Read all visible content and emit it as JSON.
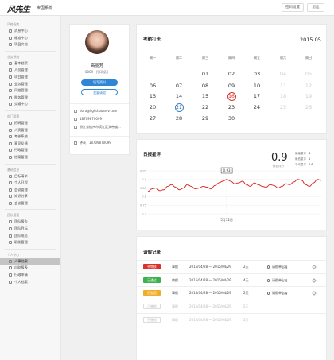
{
  "header": {
    "logo": "风先生",
    "subtitle": "帝国系统",
    "btn_password": "密码设置",
    "btn_exit": "退出"
  },
  "sidebar": {
    "sections": [
      {
        "title": "风格指南",
        "items": [
          "消息中心",
          "标准中心",
          "项目文档"
        ]
      },
      {
        "title": "业务系统",
        "items": [
          "基本档案",
          "人员管理",
          "项目管理",
          "业务管理",
          "风控管理",
          "税务管理",
          "交通中心"
        ]
      },
      {
        "title": "部门管理",
        "items": [
          "招聘管理",
          "人资管理",
          "考核系统",
          "意见反馈",
          "行政管理",
          "档案管理"
        ]
      },
      {
        "title": "基础信息",
        "items": [
          "目标清单",
          "个人日程",
          "会议管理",
          "知识分享",
          "会议管理"
        ]
      },
      {
        "title": "团队管理",
        "items": [
          "团队报告",
          "团队目标",
          "团队成员",
          "职能管理"
        ]
      },
      {
        "title": "个人中心",
        "items": [
          "人事档案",
          "自助报表",
          "行政申请",
          "个人档案"
        ]
      }
    ],
    "active": "人事档案"
  },
  "profile": {
    "name": "高丽芳",
    "employee_id": "0009",
    "position": "打印设计",
    "btn_primary": "填写资料",
    "btn_secondary": "我要请假",
    "email": "dora@lighthouse-v.com",
    "phone": "18709870099",
    "address": "浙江省杭州市滨江区关帝庙...",
    "landline_label": "钟表",
    "landline": "18709870099"
  },
  "calendar": {
    "title": "考勤打卡",
    "month": "2015.05",
    "weekdays": [
      "周一",
      "周二",
      "周三",
      "周四",
      "周五",
      "周六",
      "周日"
    ],
    "rows": [
      [
        {
          "d": ""
        },
        {
          "d": ""
        },
        {
          "d": "01"
        },
        {
          "d": "02"
        },
        {
          "d": "03"
        },
        {
          "d": "04",
          "dim": true
        },
        {
          "d": "05",
          "dim": true
        }
      ],
      [
        {
          "d": "06"
        },
        {
          "d": "07"
        },
        {
          "d": "08"
        },
        {
          "d": "09"
        },
        {
          "d": "10"
        },
        {
          "d": "11",
          "dim": true
        },
        {
          "d": "12",
          "dim": true
        }
      ],
      [
        {
          "d": "13"
        },
        {
          "d": "14"
        },
        {
          "d": "15"
        },
        {
          "d": "16",
          "ring": "red"
        },
        {
          "d": "17"
        },
        {
          "d": "18",
          "dim": true
        },
        {
          "d": "19",
          "dim": true
        }
      ],
      [
        {
          "d": "20"
        },
        {
          "d": "21",
          "ring": "blue"
        },
        {
          "d": "22"
        },
        {
          "d": "23"
        },
        {
          "d": "24"
        },
        {
          "d": "25",
          "dim": true
        },
        {
          "d": "26",
          "dim": true
        }
      ],
      [
        {
          "d": "27"
        },
        {
          "d": "28"
        },
        {
          "d": "29"
        },
        {
          "d": "30"
        },
        {
          "d": ""
        },
        {
          "d": ""
        },
        {
          "d": ""
        }
      ]
    ]
  },
  "rating": {
    "title": "日报星评",
    "score": "0.9",
    "score_sub": "综合评分",
    "legend": [
      {
        "label": "最高星评",
        "value": "4"
      },
      {
        "label": "最低星评",
        "value": "1"
      },
      {
        "label": "平均星评",
        "value": "2.6"
      }
    ],
    "tooltip": "0.93",
    "date_label": "5月12日"
  },
  "chart_data": {
    "type": "line",
    "ylim": [
      0.7,
      0.95
    ],
    "yticks": [
      "0.95",
      "0.9",
      "0.85",
      "0.8",
      "0.75",
      "0.7"
    ],
    "values": [
      0.83,
      0.845,
      0.85,
      0.835,
      0.84,
      0.86,
      0.87,
      0.855,
      0.84,
      0.85,
      0.87,
      0.86,
      0.845,
      0.85,
      0.86,
      0.855,
      0.845,
      0.865,
      0.88,
      0.89,
      0.9,
      0.89,
      0.875,
      0.88,
      0.89,
      0.87,
      0.86,
      0.88,
      0.87,
      0.86,
      0.855,
      0.87,
      0.865,
      0.85,
      0.86,
      0.875,
      0.87,
      0.885,
      0.9,
      0.895,
      0.87,
      0.86,
      0.88,
      0.9,
      0.895
    ]
  },
  "leave": {
    "title": "请假记录",
    "attachment": "请假单.jpg",
    "rows": [
      {
        "status": "待审核",
        "color": "#d9312c",
        "type": "事假",
        "range": "2015/04/28 — 2015/04/29",
        "days": "2天"
      },
      {
        "status": "已通过",
        "color": "#3db14e",
        "type": "病假",
        "range": "2015/04/28 — 2015/04/29",
        "days": "4天"
      },
      {
        "status": "已驳回",
        "color": "#f0ad28",
        "type": "事假",
        "range": "2015/04/28 — 2015/04/29",
        "days": "2天"
      },
      {
        "status": "已撤销",
        "color": "",
        "type": "事假",
        "range": "2015/04/28 — 2015/04/29",
        "days": "2天"
      },
      {
        "status": "已撤销",
        "color": "",
        "type": "事假",
        "range": "2015/04/28 — 2015/04/29",
        "days": "2天"
      }
    ]
  }
}
